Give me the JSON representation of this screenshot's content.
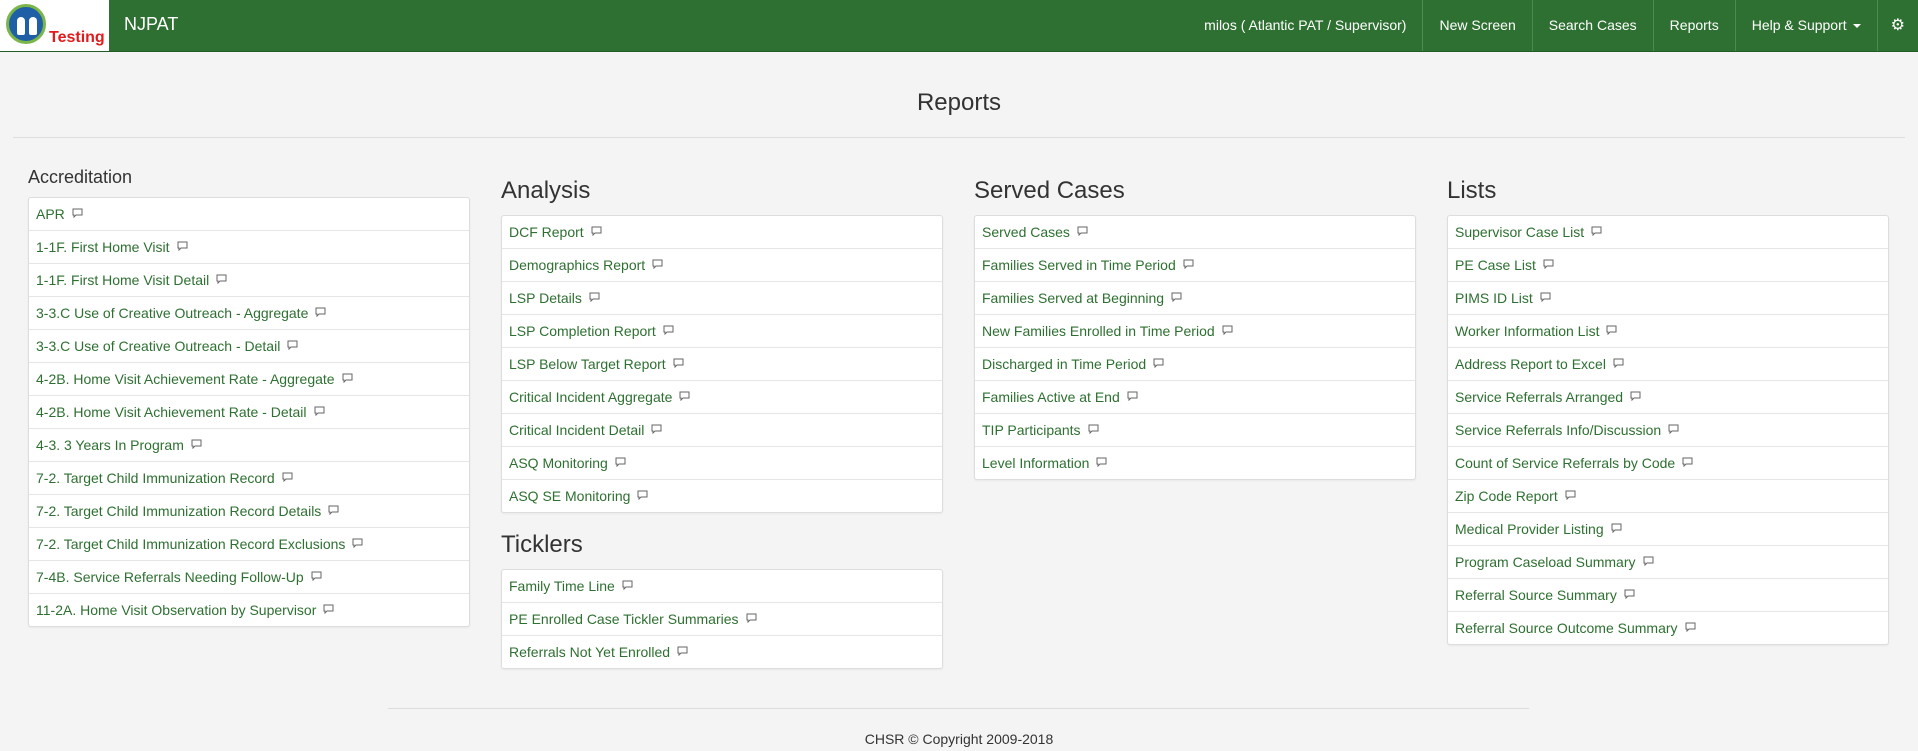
{
  "app": {
    "logo_text": "Testing",
    "brand": "NJPAT"
  },
  "nav": {
    "user": "milos  ( Atlantic PAT /  Supervisor)",
    "new_screen": "New Screen",
    "search_cases": "Search Cases",
    "reports": "Reports",
    "help_support": "Help & Support",
    "settings_icon": "gear-icon"
  },
  "page": {
    "title": "Reports",
    "footer": "CHSR © Copyright 2009-2018"
  },
  "accreditation": {
    "title": "Accreditation",
    "items": [
      "APR",
      "1-1F. First Home Visit",
      "1-1F. First Home Visit Detail",
      "3-3.C Use of Creative Outreach - Aggregate",
      "3-3.C Use of Creative Outreach - Detail",
      "4-2B. Home Visit Achievement Rate - Aggregate",
      "4-2B. Home Visit Achievement Rate - Detail",
      "4-3. 3 Years In Program",
      "7-2. Target Child Immunization Record",
      "7-2. Target Child Immunization Record Details",
      "7-2. Target Child Immunization Record Exclusions",
      "7-4B. Service Referrals Needing Follow-Up",
      "11-2A. Home Visit Observation by Supervisor"
    ]
  },
  "analysis": {
    "title": "Analysis",
    "items": [
      "DCF Report",
      "Demographics Report",
      "LSP Details",
      "LSP Completion Report",
      "LSP Below Target Report",
      "Critical Incident Aggregate",
      "Critical Incident Detail",
      "ASQ Monitoring",
      "ASQ SE Monitoring"
    ]
  },
  "ticklers": {
    "title": "Ticklers",
    "items": [
      "Family Time Line",
      "PE Enrolled Case Tickler Summaries",
      "Referrals Not Yet Enrolled"
    ]
  },
  "served_cases": {
    "title": "Served Cases",
    "items": [
      "Served Cases",
      "Families Served in Time Period",
      "Families Served at Beginning",
      "New Families Enrolled in Time Period",
      "Discharged in Time Period",
      "Families Active at End",
      "TIP Participants",
      "Level Information"
    ]
  },
  "lists": {
    "title": "Lists",
    "items": [
      "Supervisor Case List",
      "PE Case List",
      "PIMS ID List",
      "Worker Information List",
      "Address Report to Excel",
      "Service Referrals Arranged",
      "Service Referrals Info/Discussion",
      "Count of Service Referrals by Code",
      "Zip Code Report",
      "Medical Provider Listing",
      "Program Caseload Summary",
      "Referral Source Summary",
      "Referral Source Outcome Summary"
    ]
  },
  "icons": {
    "comment": "comment-icon"
  },
  "colors": {
    "navbar": "#2e7031",
    "link": "#2e7031",
    "logo_text": "#e21b1b"
  }
}
